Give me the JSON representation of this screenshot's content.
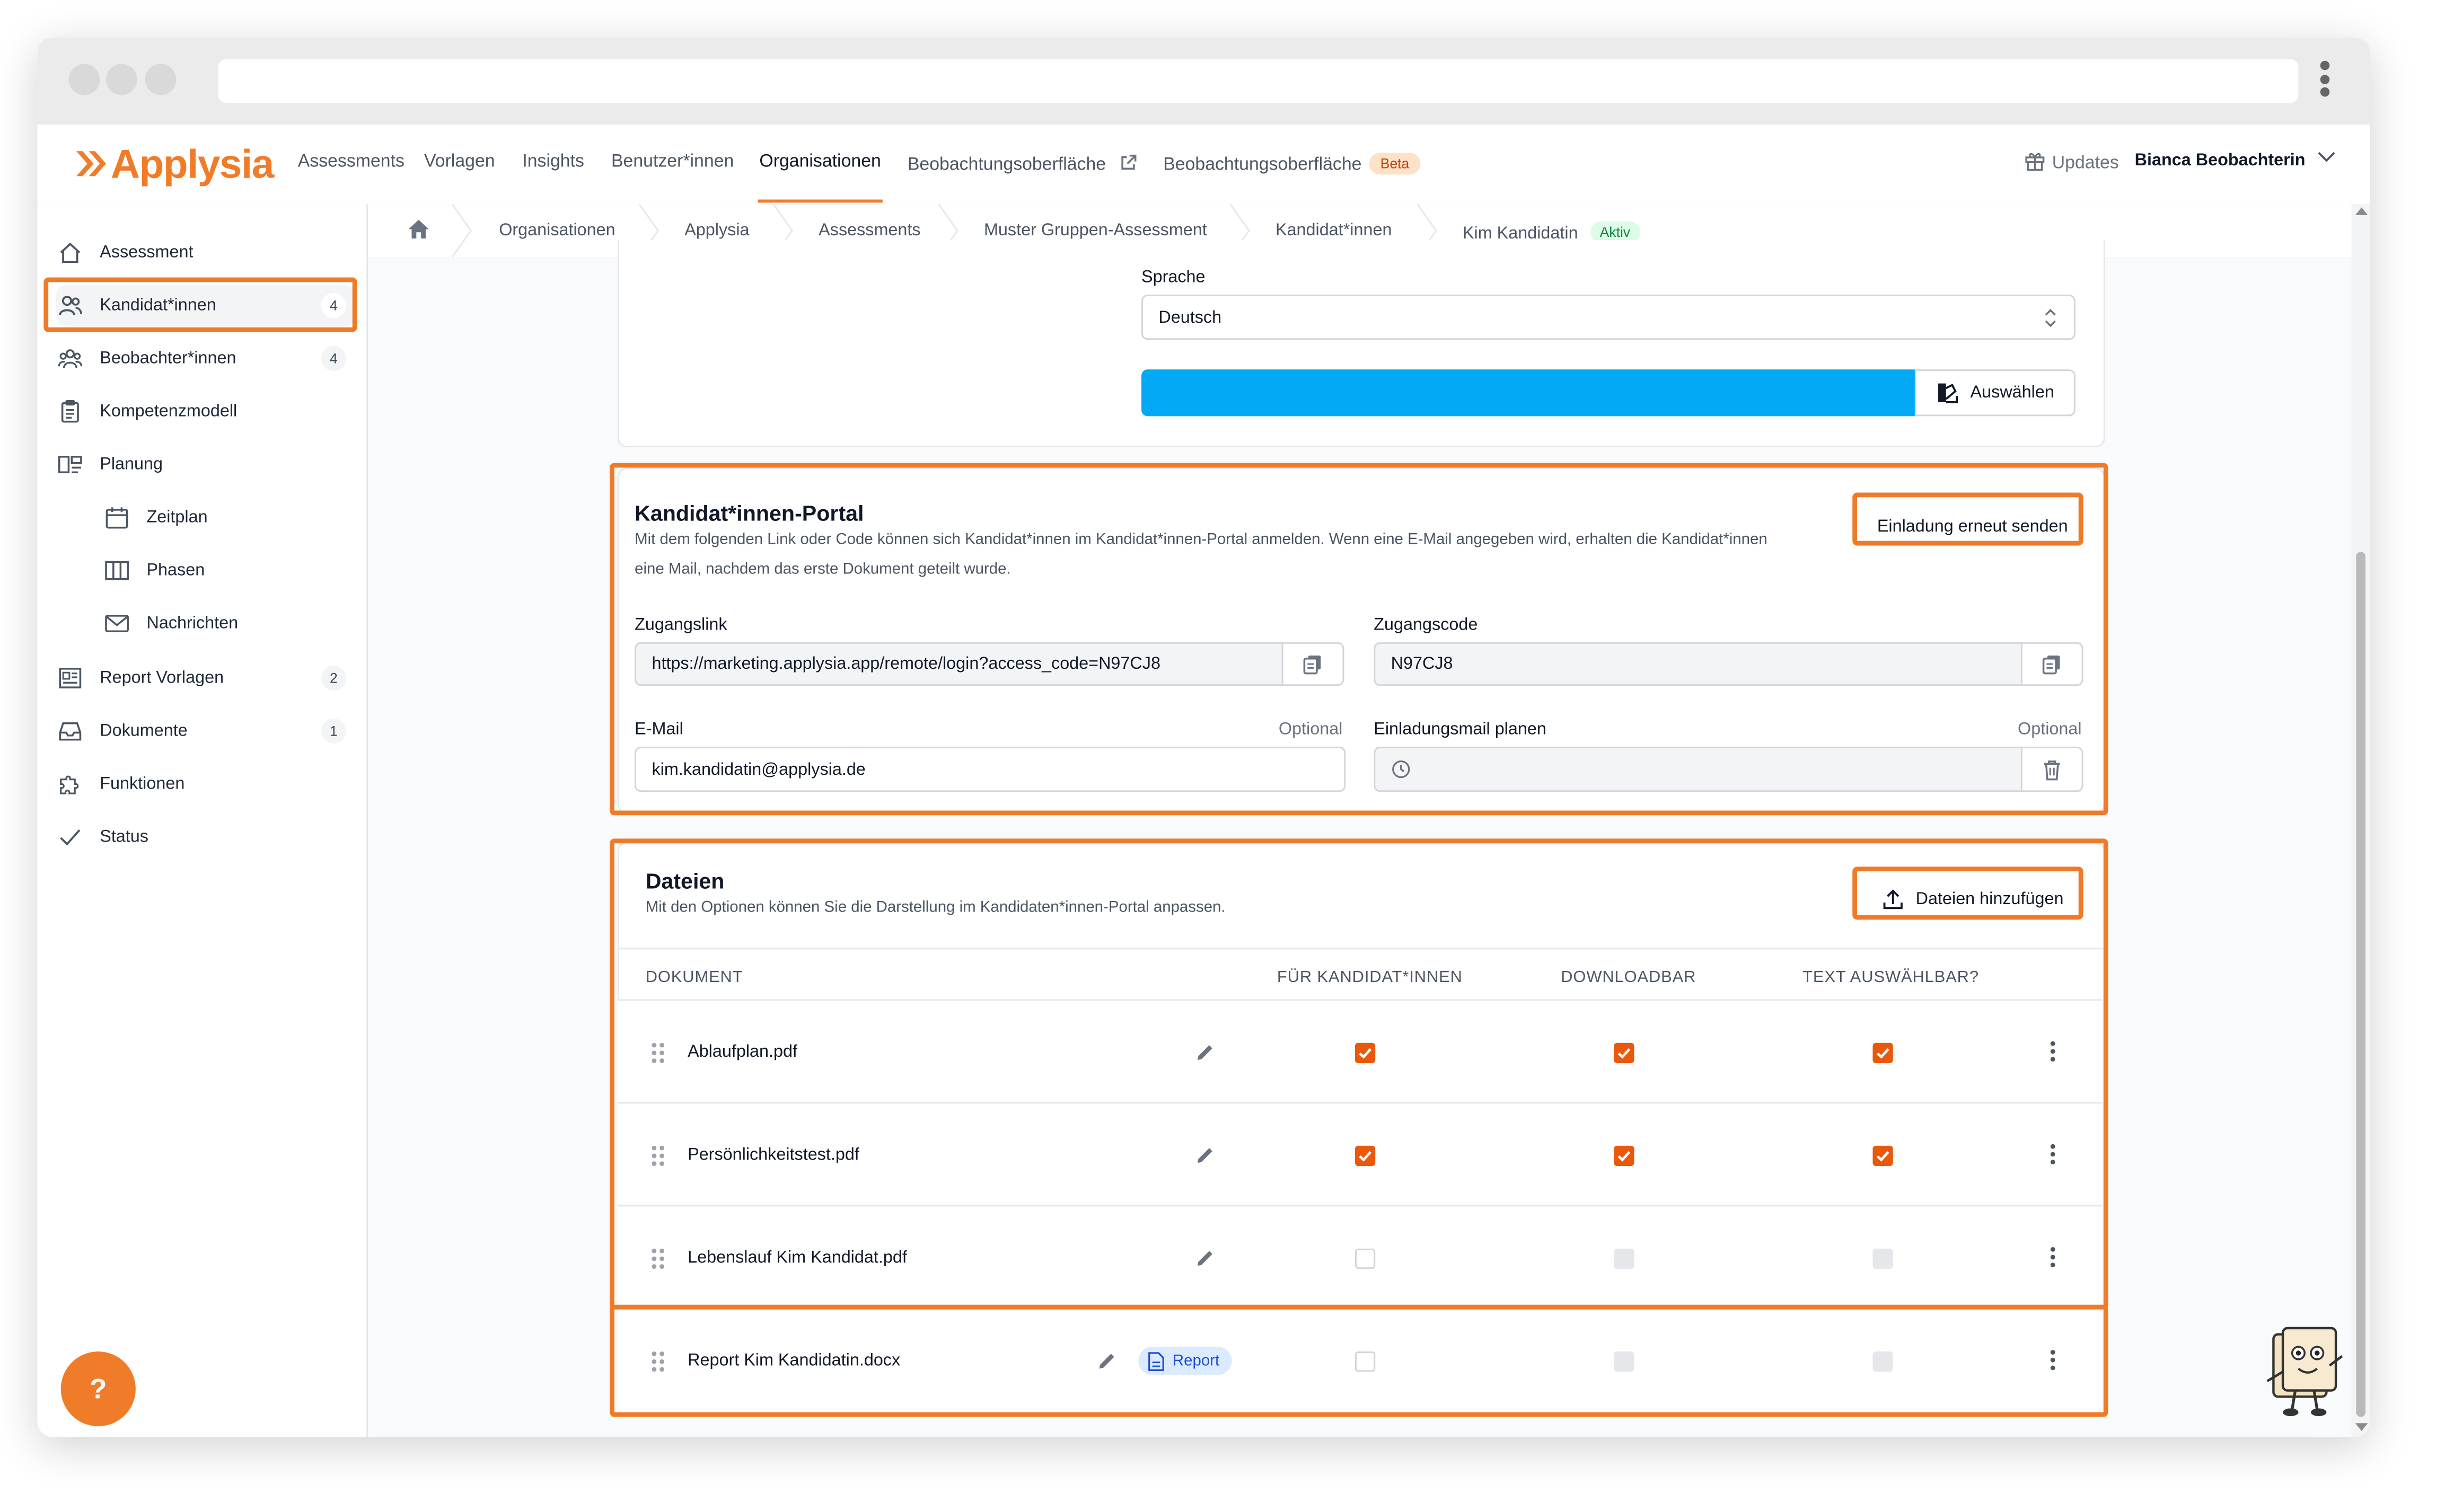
{
  "app": {
    "logo_text": "Applysia",
    "brand_color": "#f07c2a",
    "highlight_color": "#ef7b28"
  },
  "topnav": {
    "items": [
      {
        "label": "Assessments"
      },
      {
        "label": "Vorlagen"
      },
      {
        "label": "Insights"
      },
      {
        "label": "Benutzer*innen"
      },
      {
        "label": "Organisationen",
        "active": true
      },
      {
        "label": "Beobachtungsoberfläche",
        "icon": "external-link-icon"
      },
      {
        "label": "Beobachtungsoberfläche",
        "badge": "Beta"
      }
    ],
    "updates_label": "Updates",
    "user_name": "Bianca Beobachterin"
  },
  "sidebar": {
    "items": [
      {
        "label": "Assessment",
        "icon": "home-icon"
      },
      {
        "label": "Kandidat*innen",
        "icon": "users-icon",
        "badge": "4",
        "selected": true
      },
      {
        "label": "Beobachter*innen",
        "icon": "group-icon",
        "badge": "4"
      },
      {
        "label": "Kompetenzmodell",
        "icon": "clipboard-icon"
      },
      {
        "label": "Planung",
        "icon": "layout-icon"
      },
      {
        "label": "Zeitplan",
        "icon": "calendar-icon",
        "sub": true
      },
      {
        "label": "Phasen",
        "icon": "columns-icon",
        "sub": true
      },
      {
        "label": "Nachrichten",
        "icon": "mail-icon",
        "sub": true
      },
      {
        "label": "Report Vorlagen",
        "icon": "report-icon",
        "badge": "2"
      },
      {
        "label": "Dokumente",
        "icon": "inbox-icon",
        "badge": "1"
      },
      {
        "label": "Funktionen",
        "icon": "puzzle-icon"
      },
      {
        "label": "Status",
        "icon": "check-icon"
      }
    ],
    "help_label": "?"
  },
  "breadcrumb": {
    "items": [
      "Organisationen",
      "Applysia",
      "Assessments",
      "Muster Gruppen-Assessment",
      "Kandidat*innen",
      "Kim Kandidatin"
    ],
    "status_badge": "Aktiv"
  },
  "language": {
    "label": "Sprache",
    "value": "Deutsch",
    "select_button": "Auswählen",
    "color_bar": "#03a9f4"
  },
  "portal": {
    "title": "Kandidat*innen-Portal",
    "description": "Mit dem folgenden Link oder Code können sich Kandidat*innen im Kandidat*innen-Portal anmelden. Wenn eine E-Mail angegeben wird, erhalten die Kandidat*innen eine Mail, nachdem das erste Dokument geteilt wurde.",
    "resend_button": "Einladung erneut senden",
    "access_link_label": "Zugangslink",
    "access_link_value": "https://marketing.applysia.app/remote/login?access_code=N97CJ8",
    "access_code_label": "Zugangscode",
    "access_code_value": "N97CJ8",
    "email_label": "E-Mail",
    "email_optional": "Optional",
    "email_value": "kim.kandidatin@applysia.de",
    "schedule_label": "Einladungsmail planen",
    "schedule_optional": "Optional",
    "schedule_value": ""
  },
  "files": {
    "title": "Dateien",
    "description": "Mit den Optionen können Sie die Darstellung im Kandidaten*innen-Portal anpassen.",
    "add_button": "Dateien hinzufügen",
    "columns": [
      "DOKUMENT",
      "FÜR KANDIDAT*INNEN",
      "DOWNLOADBAR",
      "TEXT AUSWÄHLBAR?"
    ],
    "rows": [
      {
        "name": "Ablaufplan.pdf",
        "for_candidates": "checked",
        "downloadable": "checked",
        "text_selectable": "checked"
      },
      {
        "name": "Persönlichkeitstest.pdf",
        "for_candidates": "checked",
        "downloadable": "checked",
        "text_selectable": "checked"
      },
      {
        "name": "Lebenslauf Kim Kandidat.pdf",
        "for_candidates": "unchecked",
        "downloadable": "disabled",
        "text_selectable": "disabled"
      },
      {
        "name": "Report Kim Kandidatin.docx",
        "badge": "Report",
        "for_candidates": "unchecked",
        "downloadable": "disabled",
        "text_selectable": "disabled"
      }
    ]
  }
}
